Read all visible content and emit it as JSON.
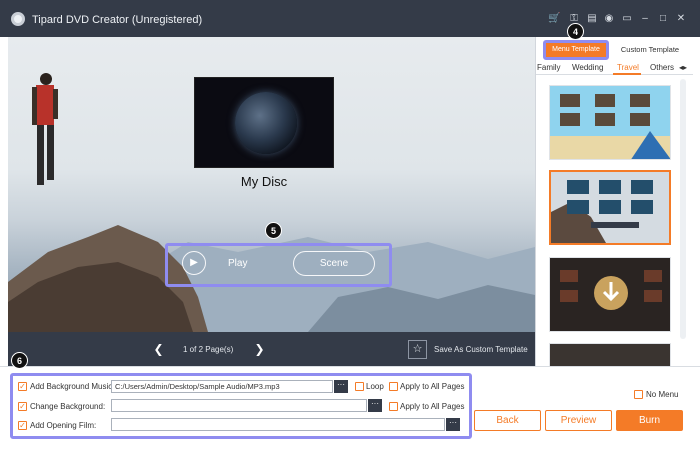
{
  "app": {
    "title": "Tipard DVD Creator (Unregistered)"
  },
  "titlebar_icons": [
    "cart-icon",
    "key-icon",
    "document-icon",
    "chat-icon",
    "feedback-icon",
    "minimize-icon",
    "maximize-icon",
    "close-icon"
  ],
  "preview": {
    "disc_title": "My Disc",
    "play_label": "Play",
    "scene_label": "Scene"
  },
  "navbar": {
    "page_info": "1 of 2 Page(s)",
    "save_template_label": "Save As Custom Template"
  },
  "side": {
    "tabs": [
      "Menu Template",
      "Custom Template"
    ],
    "categories": [
      "Family",
      "Wedding",
      "Travel",
      "Others"
    ],
    "active_category": "Travel"
  },
  "steps": {
    "four": "4",
    "five": "5",
    "six": "6"
  },
  "options": {
    "bg_music_label": "Add Background Music:",
    "bg_music_value": "C:/Users/Admin/Desktop/Sample Audio/MP3.mp3",
    "loop_label": "Loop",
    "apply_all_1": "Apply to All Pages",
    "change_bg_label": "Change Background:",
    "change_bg_value": "",
    "apply_all_2": "Apply to All Pages",
    "opening_film_label": "Add Opening Film:",
    "opening_film_value": "",
    "no_menu_label": "No Menu",
    "browse_glyph": "···"
  },
  "buttons": {
    "back": "Back",
    "preview": "Preview",
    "burn": "Burn"
  },
  "colors": {
    "accent": "#f47b27",
    "dark": "#343b48",
    "highlight": "#8f8cf0"
  }
}
